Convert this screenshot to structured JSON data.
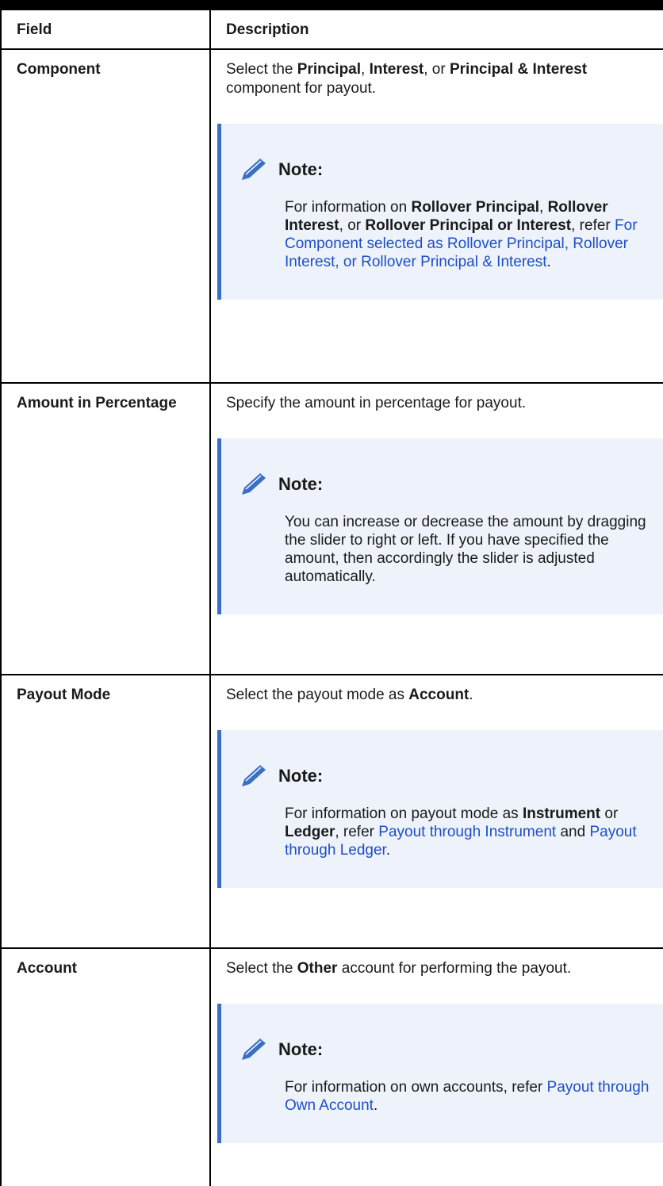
{
  "table": {
    "header": {
      "field": "Field",
      "description": "Description"
    },
    "rows": [
      {
        "field": "Component",
        "desc": [
          "Select the ",
          "Principal",
          ", ",
          "Interest",
          ", or ",
          "Principal & Interest",
          " component for payout."
        ],
        "note_label": "Note:",
        "note": [
          "For information on ",
          "Rollover Principal",
          ", ",
          "Rollover Interest",
          ", or ",
          "Rollover Principal or Interest",
          ", refer ",
          "For Component selected as Rollover Principal, Rollover Interest, or Rollover Principal & Interest",
          "."
        ]
      },
      {
        "field": "Amount in Percentage",
        "desc": [
          "Specify the amount in percentage for payout."
        ],
        "note_label": "Note:",
        "note": [
          "You can increase or decrease the amount by dragging the slider to right or left. If you have specified the amount, then accordingly the slider is adjusted automatically."
        ]
      },
      {
        "field": "Payout Mode",
        "desc": [
          "Select the payout mode as ",
          "Account",
          "."
        ],
        "note_label": "Note:",
        "note": [
          "For information on payout mode as ",
          "Instrument",
          " or ",
          "Ledger",
          ", refer ",
          "Payout through Instrument",
          " and ",
          "Payout through Ledger",
          "."
        ]
      },
      {
        "field": "Account",
        "desc": [
          "Select the ",
          "Other",
          " account for performing the payout."
        ],
        "note_label": "Note:",
        "note": [
          "For information on own accounts, refer ",
          "Payout through Own Account",
          "."
        ]
      }
    ]
  },
  "colors": {
    "accent": "#3b6fc4",
    "note_bg": "#eef3fb",
    "link": "#1d4ec7"
  },
  "icons": {
    "note": "pencil-icon"
  }
}
